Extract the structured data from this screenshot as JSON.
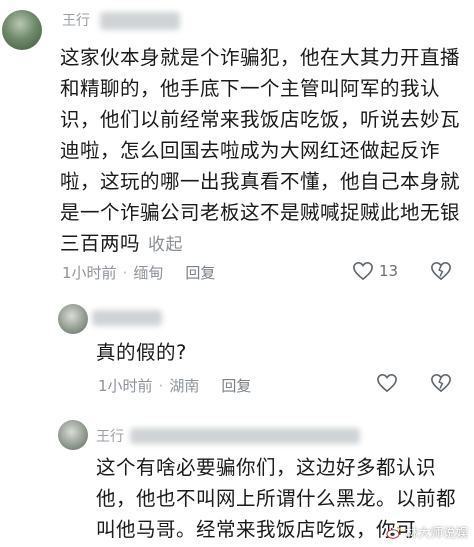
{
  "comments": [
    {
      "username": "王行",
      "text": "这家伙本身就是个诈骗犯，他在大其力开直播和精聊的，他手底下一个主管叫阿军的我认识，他们以前经常来我饭店吃饭，听说去妙瓦迪啦，怎么回国去啦成为大网红还做起反诈啦，这玩的哪一出我真看不懂，他自己本身就是一个诈骗公司老板这不是贼喊捉贼此地无银三百两吗",
      "collapse_label": "收起",
      "time": "1小时前",
      "location": "缅甸",
      "reply_label": "回复",
      "like_count": "13"
    },
    {
      "text": "真的假的?",
      "time": "1小时前",
      "location": "湖南",
      "reply_label": "回复"
    },
    {
      "username": "王行",
      "text": "这个有啥必要骗你们，这边好多都认识他，他也不叫网上所谓什么黑龙。以前都叫他马哥。经常来我饭店吃饭，你可"
    }
  ],
  "watermark": "林大师说娱",
  "colors": {
    "text": "#1a1a1a",
    "meta": "#8e949a",
    "watermark": "#ffffff"
  },
  "icons": [
    "heart-icon",
    "dislike-icon",
    "weibo-icon"
  ]
}
